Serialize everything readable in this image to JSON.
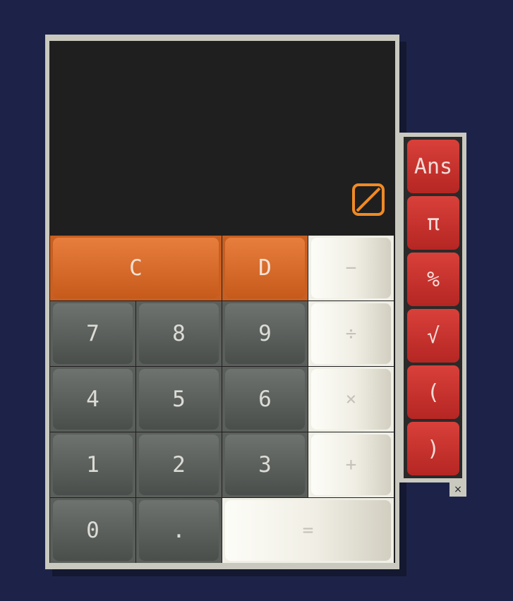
{
  "display": {
    "status_icon": "no-entry-slash-icon",
    "status_color": "#f08a25"
  },
  "keys": {
    "clear": "C",
    "delete": "D",
    "minus": "−",
    "divide": "÷",
    "multiply": "×",
    "plus": "+",
    "equals": "=",
    "seven": "7",
    "eight": "8",
    "nine": "9",
    "four": "4",
    "five": "5",
    "six": "6",
    "one": "1",
    "two": "2",
    "three": "3",
    "zero": "0",
    "dot": "."
  },
  "side_panel": {
    "ans": "Ans",
    "pi": "π",
    "percent": "%",
    "sqrt": "√",
    "lparen": "(",
    "rparen": ")"
  },
  "close_label": "×",
  "colors": {
    "background": "#1d2348",
    "orange": "#d96a28",
    "red": "#c63330",
    "dark_key": "#5b5f5b",
    "light_key": "#f0efe6"
  }
}
